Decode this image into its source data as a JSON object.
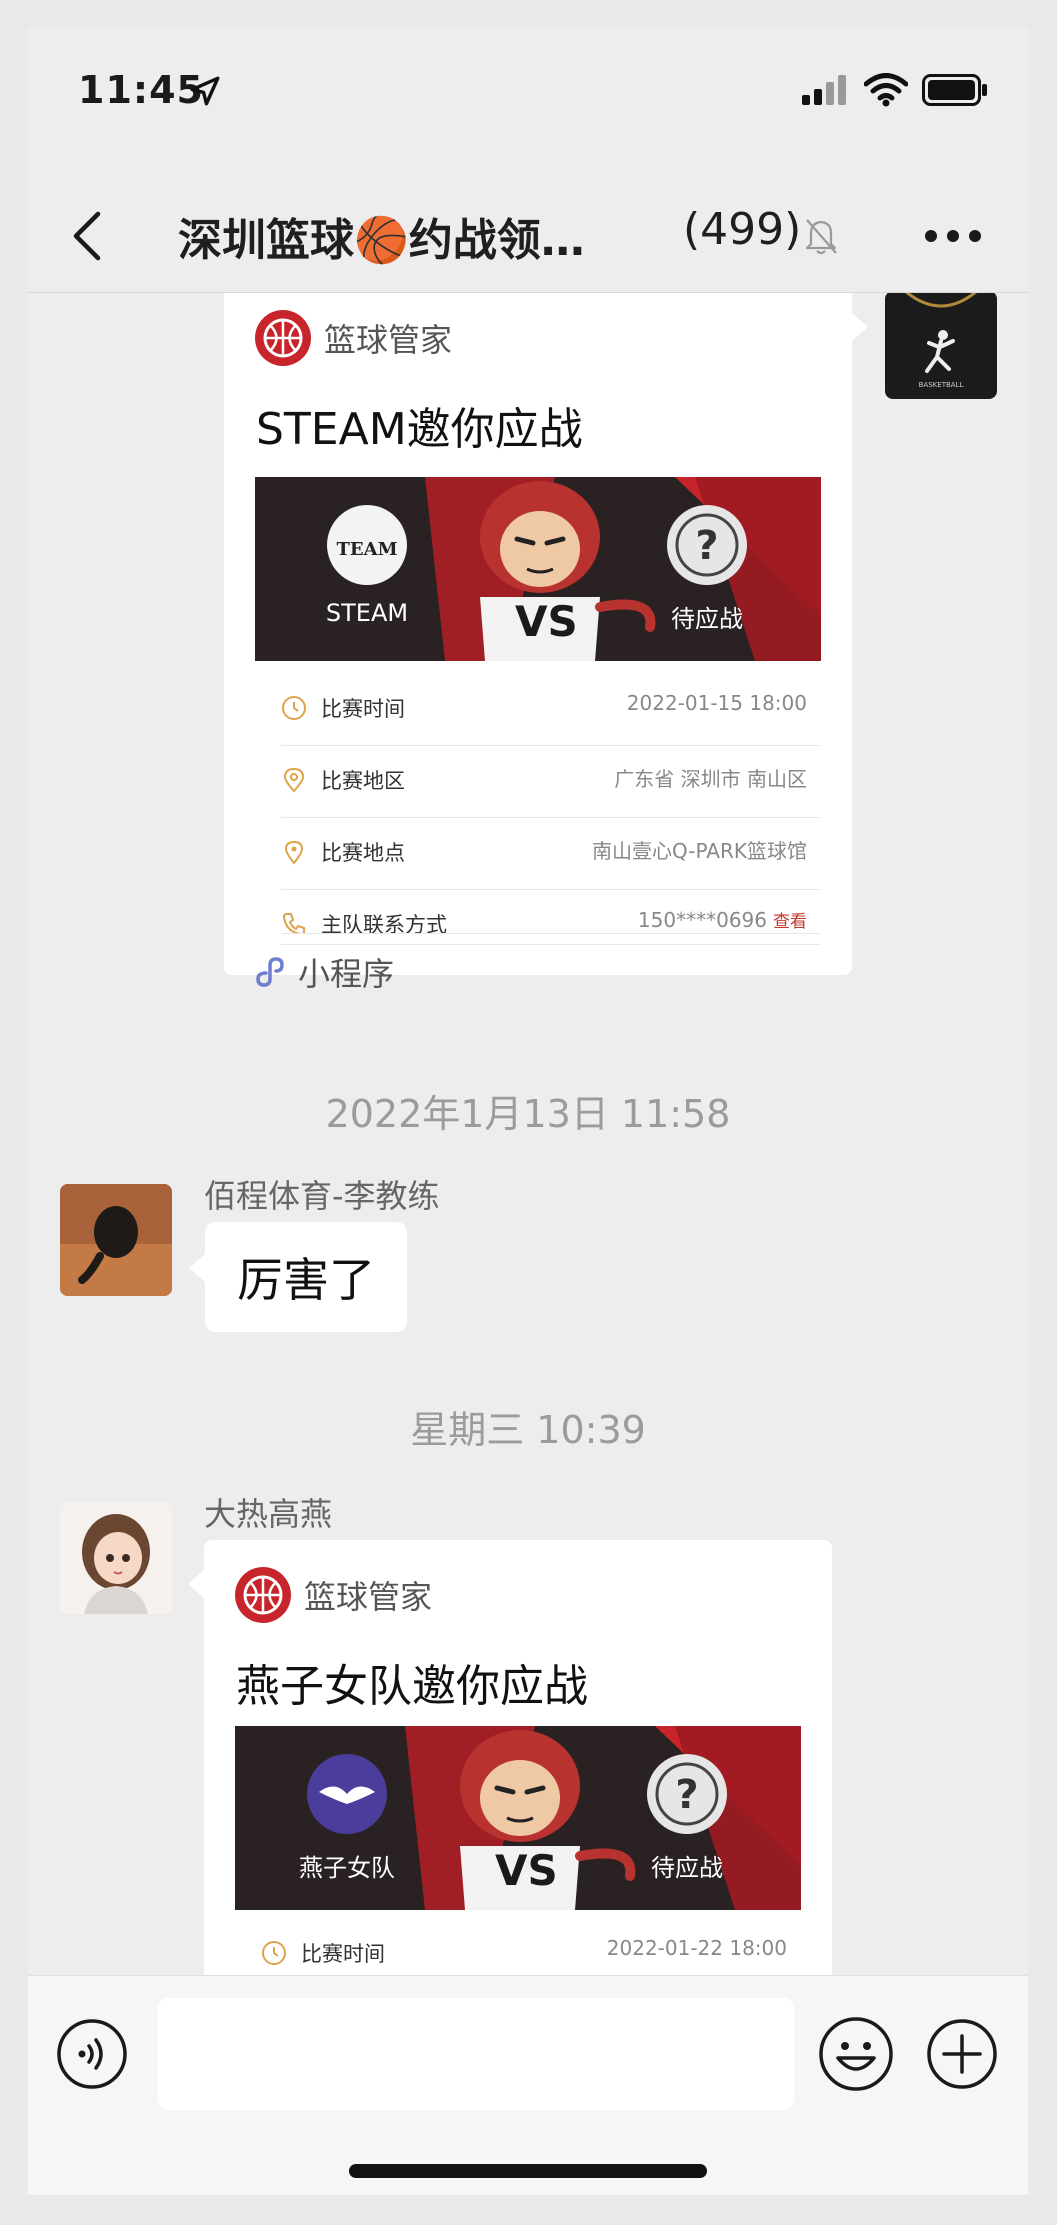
{
  "status_bar": {
    "time": "11:45"
  },
  "nav": {
    "title": "深圳篮球🏀约战领…",
    "member_count": "(499)"
  },
  "messages": {
    "card1": {
      "app_name": "篮球管家",
      "title": "STEAM邀你应战",
      "home_team": "STEAM",
      "away_team": "待应战",
      "vs": "VS",
      "rows": [
        {
          "label": "比赛时间",
          "value": "2022-01-15 18:00"
        },
        {
          "label": "比赛地区",
          "value": "广东省 深圳市 南山区"
        },
        {
          "label": "比赛地点",
          "value": "南山壹心Q-PARK篮球馆"
        },
        {
          "label": "主队联系方式",
          "value": "150****0696",
          "link": "查看"
        }
      ],
      "mini_program_label": "小程序"
    },
    "timestamp1": "2022年1月13日 11:58",
    "msg2": {
      "sender": "佰程体育-李教练",
      "text": "厉害了"
    },
    "timestamp2": "星期三 10:39",
    "card2": {
      "sender": "大热高燕",
      "app_name": "篮球管家",
      "title": "燕子女队邀你应战",
      "home_team": "燕子女队",
      "away_team": "待应战",
      "vs": "VS",
      "rows": [
        {
          "label": "比赛时间",
          "value": "2022-01-22 18:00"
        }
      ]
    }
  },
  "colors": {
    "brand_red": "#c8242b",
    "banner_dark": "#2a2122",
    "background": "#ededed"
  }
}
